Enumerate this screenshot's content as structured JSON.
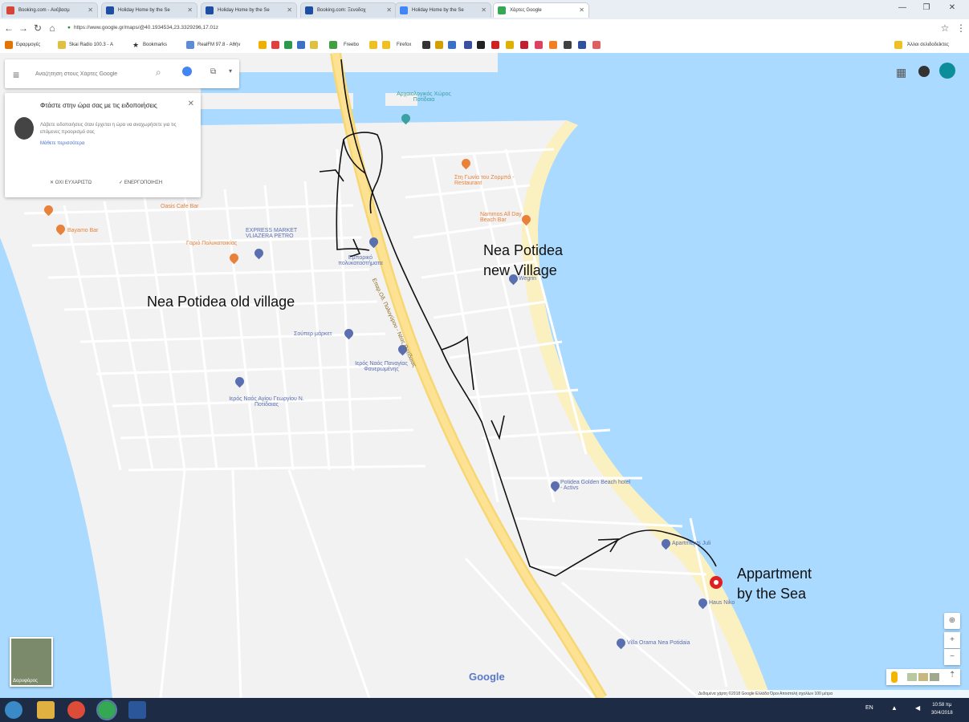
{
  "browser": {
    "tabs": [
      {
        "label": "Booking.com - Ανέβασμ",
        "icon": "gmail-icon",
        "color": "#d44638"
      },
      {
        "label": "Holiday Home by the Se",
        "icon": "booking-icon",
        "color": "#1f4fa3"
      },
      {
        "label": "Holiday Home by the Se",
        "icon": "booking-icon",
        "color": "#1f4fa3"
      },
      {
        "label": "Booking.com: Ξενοδοχ",
        "icon": "booking-icon",
        "color": "#1f4fa3"
      },
      {
        "label": "Holiday Home by the Se",
        "icon": "maps-pin-icon",
        "color": "#4285f4"
      },
      {
        "label": "Χάρτες Google",
        "icon": "maps-icon",
        "color": "#34a853"
      }
    ],
    "url": "https://www.google.gr/maps/@40.1934534,23.3329296,17.01z",
    "bookmarks": [
      "Εφαρμογές",
      "Skai Radio 100.3 - Α",
      "Bookmarks",
      "RealFM 97.8 - Αθήν",
      "Freebo",
      "Firefox"
    ],
    "other_bookmarks": "Άλλοι σελιδοδείκτες"
  },
  "map": {
    "search_placeholder": "Αναζήτηση στους Χάρτες Google",
    "popup": {
      "title": "Φτάστε στην ώρα σας με τις ειδοποιήσεις",
      "body": "Λάβετε ειδοποιήσεις όταν έρχεται η ώρα να αναχωρήσετε για τις επόμενες προορισμό σας",
      "link": "Μάθετε περισσότερα",
      "dismiss": "ΟΧΙ ΕΥΧΑΡΙΣΤΩ",
      "enable": "ΕΝΕΡΓΟΠΟΙΗΣΗ"
    },
    "pois": [
      {
        "name": "Αρχαιολογικός Χώρος Ποτίδαια",
        "kind": "teal"
      },
      {
        "name": "Στη Γωνία του Ζορμπά - Restaurant",
        "kind": "orange"
      },
      {
        "name": "Oasis Cafe Bar",
        "kind": "orange"
      },
      {
        "name": "Bayamo Bar",
        "kind": "orange"
      },
      {
        "name": "EXPRESS MARKET VLIAZERA PETRO",
        "kind": "blue"
      },
      {
        "name": "Γαριό Πολυκατοικίας",
        "kind": "orange"
      },
      {
        "name": "Εμπορικό πολυκαταστήματα",
        "kind": "blue"
      },
      {
        "name": "Nammos All Day Beach Bar",
        "kind": "orange"
      },
      {
        "name": "Wegrin",
        "kind": "blue"
      },
      {
        "name": "Σούπερ μάρκετ",
        "kind": "blue"
      },
      {
        "name": "Ιερός Ναός Παναγίας Φανερωμένης",
        "kind": "blue"
      },
      {
        "name": "Ιερός Ναός Αγίου Γεωργίου Ν. Ποτίδαιας",
        "kind": "blue"
      },
      {
        "name": "Potidea Golden Beach hotel - Activs",
        "kind": "blue"
      },
      {
        "name": "Apartments Juli",
        "kind": "blue"
      },
      {
        "name": "Haus Niko",
        "kind": "blue"
      },
      {
        "name": "Villa Orama Nea Potidaia",
        "kind": "blue"
      }
    ],
    "road_label": "Επαρ.Οδ. Πολυγύρου - Νέας Ποτίδαιας",
    "annotations": {
      "old_village": "Nea Potidea old village",
      "new_village_1": "Nea Potidea",
      "new_village_2": "new Village",
      "apartment_1": "Appartment",
      "apartment_2": "by the Sea"
    },
    "satellite_label": "Δορυφόρος",
    "google_logo": "Google",
    "footer": "Δεδομένα χάρτη ©2018 Google   Ελλάδα   Όροι   Αποστολή σχολίων   100 μέτρα"
  },
  "taskbar": {
    "lang": "EN",
    "time": "10:58 πμ",
    "date": "30/4/2018"
  }
}
